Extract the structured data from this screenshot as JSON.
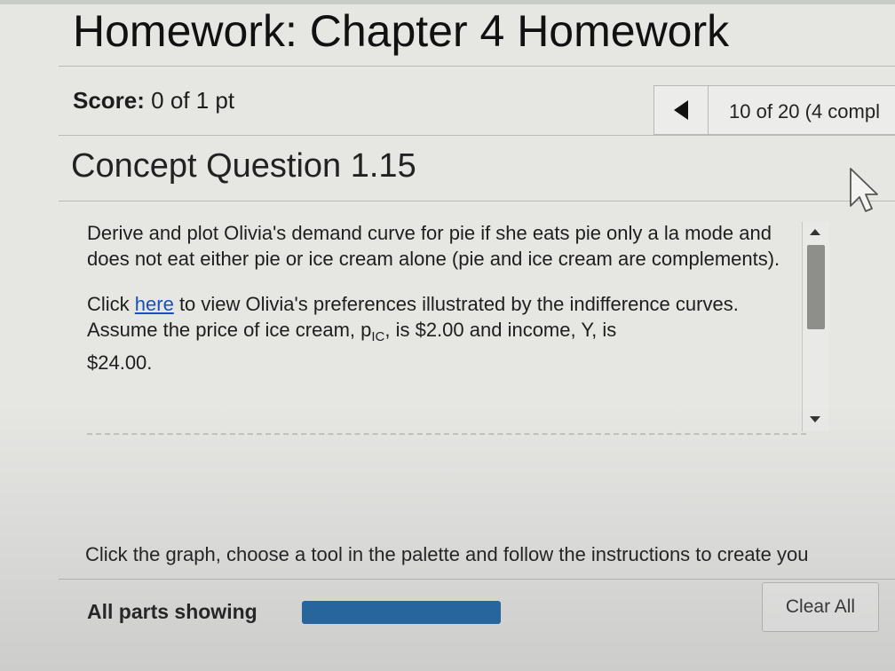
{
  "header": {
    "title": "Homework: Chapter 4 Homework"
  },
  "score": {
    "label": "Score:",
    "value": "0 of 1 pt"
  },
  "navigation": {
    "progress_text": "10 of 20 (4 compl"
  },
  "question": {
    "title": "Concept Question 1.15",
    "paragraph1": "Derive and plot Olivia's demand curve for pie if she eats pie only a la mode and does not eat either pie or ice cream alone (pie and ice cream are complements).",
    "p2_before_link": "Click ",
    "p2_link": "here",
    "p2_after_link": " to view Olivia's preferences illustrated by the indifference curves. Assume the price of ice cream, p",
    "p2_subscript": "IC",
    "p2_end": ", is $2.00 and income, Y, is",
    "p2_line3": "$24.00."
  },
  "instructions": "Click the graph, choose a tool in the palette and follow the instructions to create you",
  "parts": {
    "label": "All parts showing",
    "progress_fraction": 1.0
  },
  "buttons": {
    "clear_all": "Clear All"
  },
  "colors": {
    "link": "#1a4fc0",
    "progress_fill": "#1e67a6"
  },
  "icons": [
    "arrow-left-icon",
    "mouse-pointer-icon",
    "scroll-up-icon",
    "scroll-down-icon"
  ]
}
